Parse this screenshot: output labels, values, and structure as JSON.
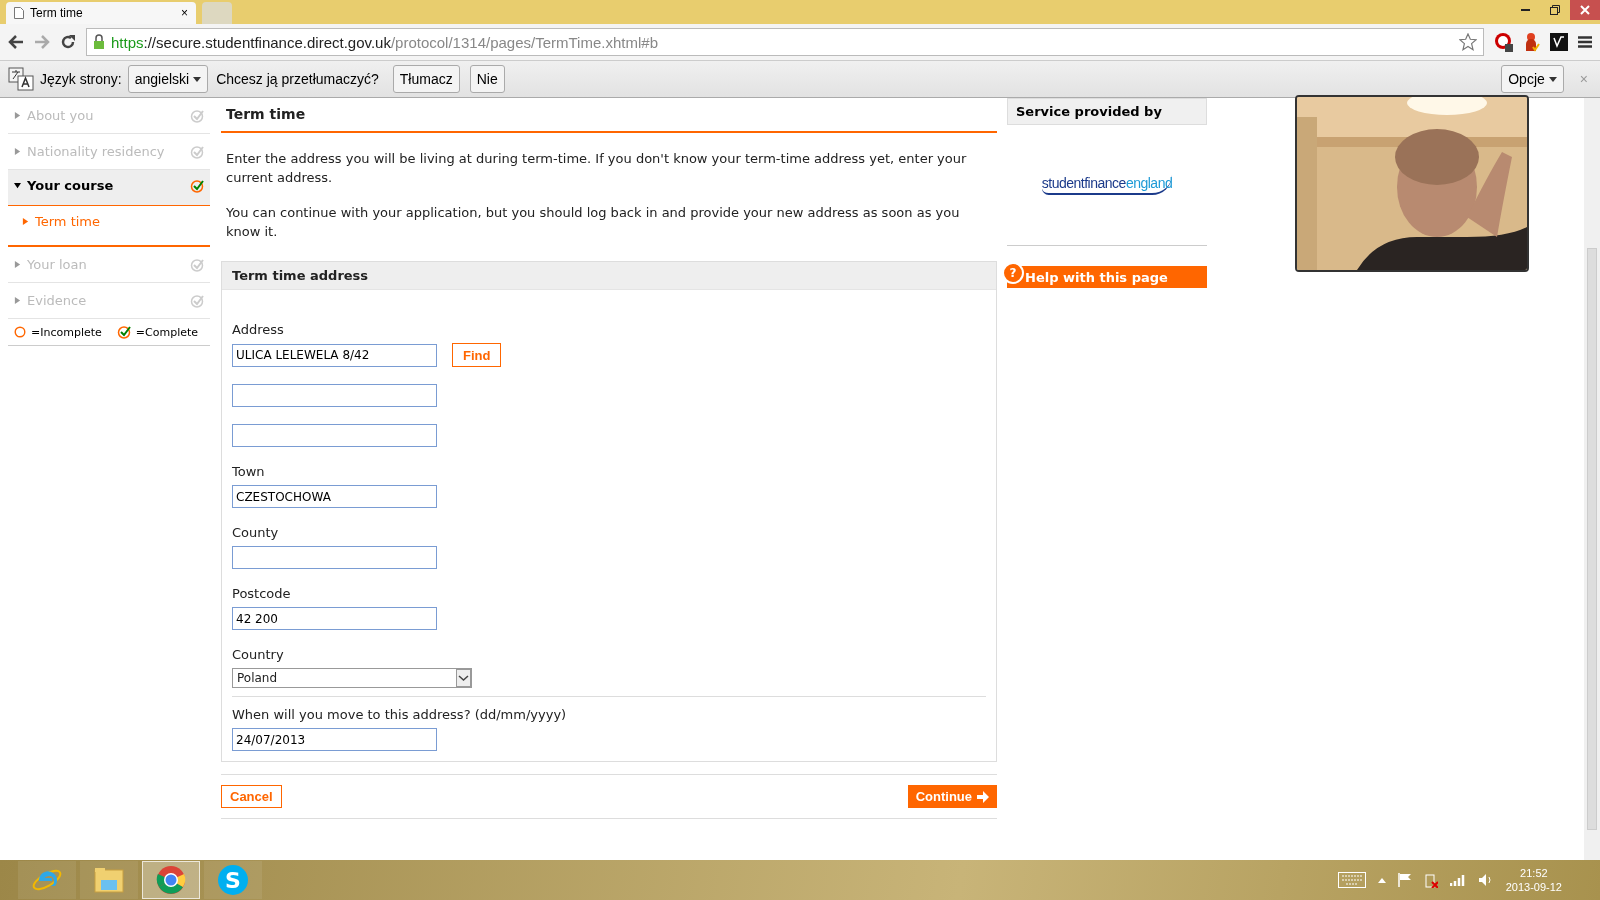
{
  "browser": {
    "tabs": [
      {
        "title": "Term time",
        "close": "×",
        "selected": true
      },
      {
        "selected": false
      }
    ],
    "url": {
      "scheme": "https",
      "host": "://secure.studentfinance.direct.gov.uk",
      "path": "/protocol/1314/pages/TermTime.xhtml#b"
    }
  },
  "translate_bar": {
    "label": "Język strony:",
    "language": "angielski",
    "question": "Chcesz ją przetłumaczyć?",
    "buttons": [
      "Tłumacz",
      "Nie"
    ],
    "options": "Opcje",
    "close": "×"
  },
  "sidebar": {
    "items": [
      {
        "label": "About you",
        "expanded": false,
        "selected": false
      },
      {
        "label": "Nationality residency",
        "expanded": false,
        "selected": false
      },
      {
        "label": "Your course",
        "expanded": true,
        "selected": true,
        "children": [
          {
            "label": "Term time",
            "selected": true
          }
        ]
      },
      {
        "label": "Your loan",
        "expanded": false,
        "selected": false
      },
      {
        "label": "Evidence",
        "expanded": false,
        "selected": false
      }
    ],
    "legend": [
      "=Incomplete",
      "=Complete"
    ]
  },
  "page": {
    "title": "Term time",
    "intro": [
      "Enter the address you will be living at during term-time. If you don't know your term-time address yet, enter your current address.",
      "You can continue with your application, but you should log back in and provide your new address as soon as you know it."
    ],
    "section_title": "Term time address",
    "fields": [
      {
        "label": "Address",
        "inputs": [
          {
            "kind": "filled",
            "value": "ULICA LELEWELA 8/42"
          },
          {
            "kind": "empty"
          },
          {
            "kind": "empty"
          }
        ],
        "button": "Find"
      },
      {
        "label": "Town",
        "inputs": [
          {
            "kind": "filled",
            "value": "CZESTOCHOWA"
          }
        ]
      },
      {
        "label": "County",
        "inputs": [
          {
            "kind": "empty"
          }
        ]
      },
      {
        "label": "Postcode",
        "inputs": [
          {
            "kind": "filled",
            "value": "42 200"
          }
        ]
      }
    ],
    "country": {
      "label": "Country",
      "value": "Poland"
    },
    "move_date": {
      "label": "When will you move to this address? (dd/mm/yyyy)",
      "value": "24/07/2013"
    },
    "cancel": "Cancel",
    "continue": "Continue"
  },
  "aside": {
    "title": "Service provided by",
    "logo": [
      "studentfinance",
      "england"
    ],
    "help": "Help with this page",
    "help_icon": "?"
  },
  "taskbar": {
    "apps": [
      {
        "kind": "ie",
        "selected": false
      },
      {
        "kind": "explorer",
        "selected": false
      },
      {
        "kind": "chrome",
        "selected": true
      },
      {
        "kind": "skype",
        "selected": false,
        "letter": "S"
      }
    ],
    "time": "21:52",
    "date": "2013-09-12"
  }
}
